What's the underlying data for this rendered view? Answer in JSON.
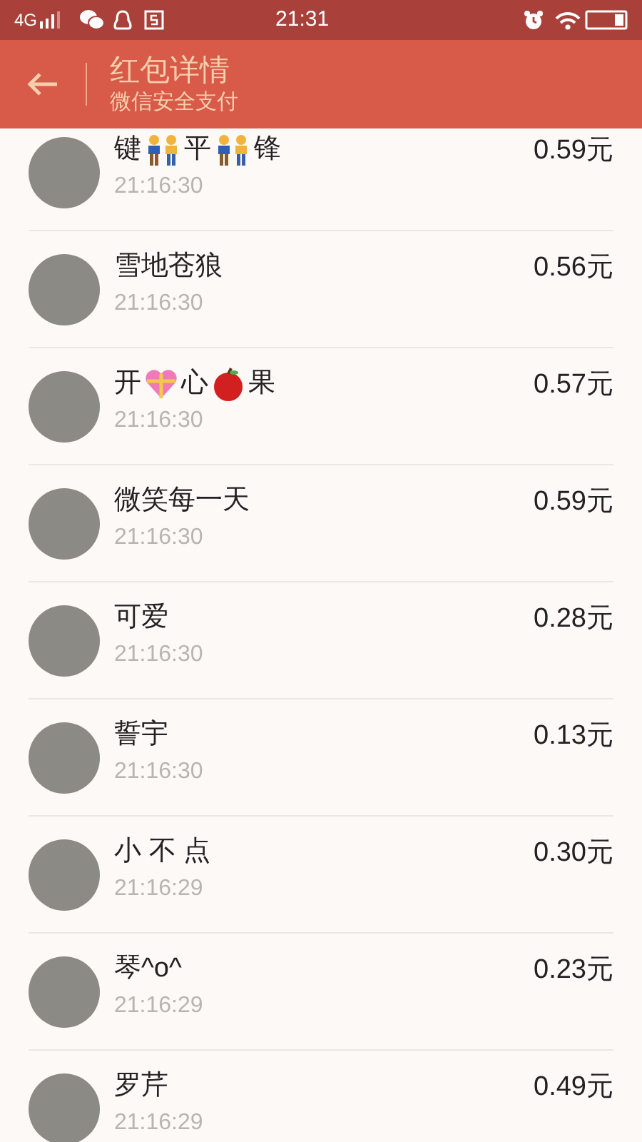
{
  "status_bar": {
    "network": "4G",
    "time": "21:31"
  },
  "header": {
    "title": "红包详情",
    "subtitle": "微信安全支付"
  },
  "rows": [
    {
      "name_parts": [
        {
          "kind": "text",
          "text": "键"
        },
        {
          "kind": "couple"
        },
        {
          "kind": "text",
          "text": "平"
        },
        {
          "kind": "couple"
        },
        {
          "kind": "text",
          "text": "锋"
        }
      ],
      "time": "21:16:30",
      "amount": "0.59元"
    },
    {
      "name_parts": [
        {
          "kind": "text",
          "text": "雪地苍狼"
        }
      ],
      "time": "21:16:30",
      "amount": "0.56元"
    },
    {
      "name_parts": [
        {
          "kind": "text",
          "text": "开"
        },
        {
          "kind": "gift-heart"
        },
        {
          "kind": "text",
          "text": "心"
        },
        {
          "kind": "apple"
        },
        {
          "kind": "text",
          "text": "果"
        }
      ],
      "time": "21:16:30",
      "amount": "0.57元"
    },
    {
      "name_parts": [
        {
          "kind": "text",
          "text": "微笑每一天"
        }
      ],
      "time": "21:16:30",
      "amount": "0.59元"
    },
    {
      "name_parts": [
        {
          "kind": "text",
          "text": "可爱"
        }
      ],
      "time": "21:16:30",
      "amount": "0.28元"
    },
    {
      "name_parts": [
        {
          "kind": "text",
          "text": "誓宇"
        }
      ],
      "time": "21:16:30",
      "amount": "0.13元"
    },
    {
      "name_parts": [
        {
          "kind": "text",
          "text": "小 不 点"
        }
      ],
      "time": "21:16:29",
      "amount": "0.30元"
    },
    {
      "name_parts": [
        {
          "kind": "text",
          "text": "琴^o^"
        }
      ],
      "time": "21:16:29",
      "amount": "0.23元"
    },
    {
      "name_parts": [
        {
          "kind": "text",
          "text": "罗芹"
        }
      ],
      "time": "21:16:29",
      "amount": "0.49元"
    }
  ]
}
